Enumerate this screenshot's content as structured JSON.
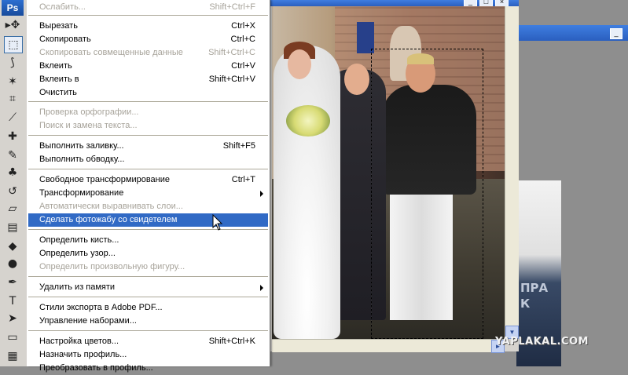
{
  "app": {
    "logo": "Ps"
  },
  "tools": [
    {
      "name": "move-tool-icon",
      "glyph": "▸✥"
    },
    {
      "name": "marquee-tool-icon",
      "glyph": "⬚",
      "selected": true
    },
    {
      "name": "lasso-tool-icon",
      "glyph": "⟆"
    },
    {
      "name": "magic-wand-tool-icon",
      "glyph": "✶"
    },
    {
      "name": "crop-tool-icon",
      "glyph": "⌗"
    },
    {
      "name": "slice-tool-icon",
      "glyph": "⟋"
    },
    {
      "name": "healing-brush-tool-icon",
      "glyph": "✚"
    },
    {
      "name": "brush-tool-icon",
      "glyph": "✎"
    },
    {
      "name": "stamp-tool-icon",
      "glyph": "♣"
    },
    {
      "name": "history-brush-tool-icon",
      "glyph": "↺"
    },
    {
      "name": "eraser-tool-icon",
      "glyph": "▱"
    },
    {
      "name": "gradient-tool-icon",
      "glyph": "▤"
    },
    {
      "name": "blur-tool-icon",
      "glyph": "◆"
    },
    {
      "name": "dodge-tool-icon",
      "glyph": "●"
    },
    {
      "name": "pen-tool-icon",
      "glyph": "✒"
    },
    {
      "name": "type-tool-icon",
      "glyph": "T"
    },
    {
      "name": "path-selection-tool-icon",
      "glyph": "➤"
    },
    {
      "name": "shape-tool-icon",
      "glyph": "▭"
    },
    {
      "name": "notes-tool-icon",
      "glyph": "▦"
    }
  ],
  "menu": {
    "items": [
      {
        "label": "Ослабить...",
        "shortcut": "Shift+Ctrl+F",
        "disabled": true
      },
      {
        "sep": true
      },
      {
        "label": "Вырезать",
        "shortcut": "Ctrl+X"
      },
      {
        "label": "Скопировать",
        "shortcut": "Ctrl+C"
      },
      {
        "label": "Скопировать совмещенные данные",
        "shortcut": "Shift+Ctrl+C",
        "disabled": true
      },
      {
        "label": "Вклеить",
        "shortcut": "Ctrl+V"
      },
      {
        "label": "Вклеить в",
        "shortcut": "Shift+Ctrl+V"
      },
      {
        "label": "Очистить",
        "shortcut": ""
      },
      {
        "sep": true
      },
      {
        "label": "Проверка орфографии...",
        "shortcut": "",
        "disabled": true
      },
      {
        "label": "Поиск и замена текста...",
        "shortcut": "",
        "disabled": true
      },
      {
        "sep": true
      },
      {
        "label": "Выполнить заливку...",
        "shortcut": "Shift+F5"
      },
      {
        "label": "Выполнить обводку...",
        "shortcut": ""
      },
      {
        "sep": true
      },
      {
        "label": "Свободное трансформирование",
        "shortcut": "Ctrl+T"
      },
      {
        "label": "Трансформирование",
        "shortcut": "",
        "submenu": true
      },
      {
        "label": "Автоматически выравнивать слои...",
        "shortcut": "",
        "disabled": true
      },
      {
        "label": "Сделать фотожабу со свидетелем",
        "shortcut": "",
        "highlighted": true
      },
      {
        "sep": true
      },
      {
        "label": "Определить кисть...",
        "shortcut": ""
      },
      {
        "label": "Определить узор...",
        "shortcut": ""
      },
      {
        "label": "Определить произвольную фигуру...",
        "shortcut": "",
        "disabled": true
      },
      {
        "sep": true
      },
      {
        "label": "Удалить из памяти",
        "shortcut": "",
        "submenu": true
      },
      {
        "sep": true
      },
      {
        "label": "Стили экспорта в Adobe PDF...",
        "shortcut": ""
      },
      {
        "label": "Управление наборами...",
        "shortcut": ""
      },
      {
        "sep": true
      },
      {
        "label": "Настройка цветов...",
        "shortcut": "Shift+Ctrl+K"
      },
      {
        "label": "Назначить профиль...",
        "shortcut": ""
      },
      {
        "label": "Преобразовать в профиль...",
        "shortcut": ""
      }
    ]
  },
  "photo_window": {
    "buttons": {
      "minimize": "_",
      "maximize": "□",
      "close": "×"
    }
  },
  "bg_window": {
    "minimize": "_"
  },
  "bg_photo_text": {
    "line1": "ПРА",
    "line2": "К"
  },
  "watermark": "YAPLAKAL.COM"
}
